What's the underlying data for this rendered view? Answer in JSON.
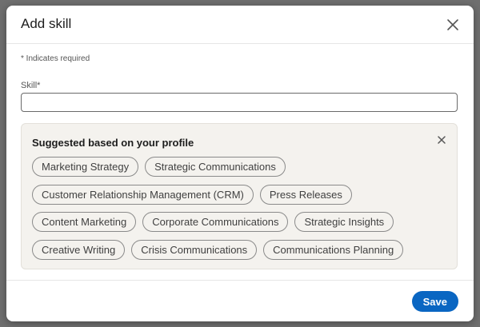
{
  "modal": {
    "title": "Add skill",
    "required_note": "* Indicates required"
  },
  "skill_field": {
    "label": "Skill*",
    "value": "",
    "placeholder": ""
  },
  "suggestions": {
    "title": "Suggested based on your profile",
    "rows": [
      [
        "Marketing Strategy",
        "Strategic Communications"
      ],
      [
        "Customer Relationship Management (CRM)",
        "Press Releases"
      ],
      [
        "Content Marketing",
        "Corporate Communications",
        "Strategic Insights"
      ],
      [
        "Creative Writing",
        "Crisis Communications",
        "Communications Planning"
      ]
    ]
  },
  "footer": {
    "save_label": "Save"
  },
  "colors": {
    "accent": "#0a66c2",
    "suggest_bg": "#f4f2ee"
  },
  "icons": {
    "modal_close": "close-icon",
    "suggest_close": "close-icon"
  }
}
